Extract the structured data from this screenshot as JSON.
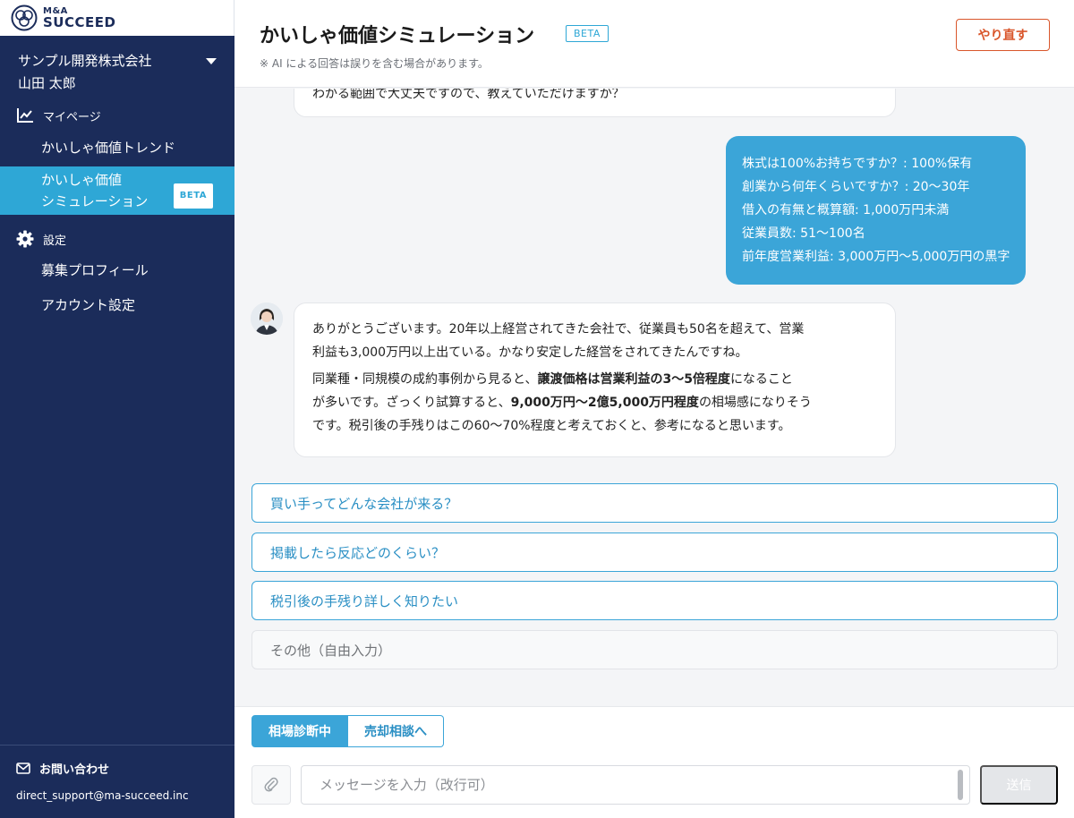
{
  "logo": {
    "line1": "M&A",
    "line2": "SUCCEED"
  },
  "sidebar": {
    "company_name": "サンプル開発株式会社",
    "user_name": "山田 太郎",
    "mypage_label": "マイページ",
    "items_mypage": [
      {
        "label": "かいしゃ価値トレンド"
      },
      {
        "label_line1": "かいしゃ価値",
        "label_line2": "シミュレーション",
        "badge": "BETA"
      }
    ],
    "settings_label": "設定",
    "items_settings": [
      {
        "label": "募集プロフィール"
      },
      {
        "label": "アカウント設定"
      }
    ],
    "contact_title": "お問い合わせ",
    "contact_email": "direct_support@ma-succeed.inc"
  },
  "header": {
    "title": "かいしゃ価値シミュレーション",
    "badge": "BETA",
    "note": "※ AI による回答は誤りを含む場合があります。",
    "redo_label": "やり直す"
  },
  "chat": {
    "bot_prev_tail": "わかる範囲で大丈夫ですので、教えていただけますか？",
    "user_answers": [
      "株式は100%お持ちですか？: 100%保有",
      "創業から何年くらいですか？: 20〜30年",
      "借入の有無と概算額: 1,000万円未満",
      "従業員数: 51〜100名",
      "前年度営業利益: 3,000万円〜5,000万円の黒字"
    ],
    "bot_reply": {
      "p1_line1": "ありがとうございます。20年以上経営されてきた会社で、従業員も50名を超えて、営業",
      "p1_line2": "利益も3,000万円以上出ている。かなり安定した経営をされてきたんですね。",
      "p2_a": "同業種・同規模の成約事例から見ると、",
      "p2_bold1": "譲渡価格は営業利益の3〜5倍程度",
      "p2_b": "になること",
      "p2_line2a": "が多いです。ざっくり試算すると、",
      "p2_bold2": "9,000万円〜2億5,000万円程度",
      "p2_line2b": "の相場感になりそう",
      "p2_line3": "です。税引後の手残りはこの60〜70%程度と考えておくと、参考になると思います。"
    },
    "suggestions": [
      "買い手ってどんな会社が来る？",
      "掲載したら反応どのくらい？",
      "税引後の手残り詳しく知りたい"
    ],
    "other_label": "その他（自由入力）"
  },
  "footer": {
    "tab_active": "相場診断中",
    "tab_other": "売却相談へ",
    "input_placeholder": "メッセージを入力（改行可）",
    "send_label": "送信"
  },
  "colors": {
    "sidebar_bg": "#1b2c5a",
    "accent": "#3ba5d8",
    "redo": "#d9562b"
  }
}
